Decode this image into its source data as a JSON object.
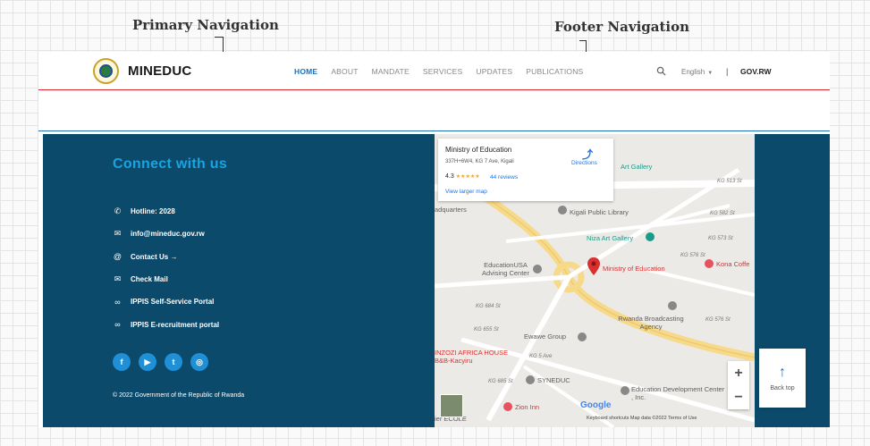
{
  "annotations": {
    "primary_nav": "Primary Navigation",
    "footer_nav": "Footer Navigation"
  },
  "header": {
    "brand": "MINEDUC",
    "nav": [
      "HOME",
      "ABOUT",
      "MANDATE",
      "SERVICES",
      "UPDATES",
      "PUBLICATIONS"
    ],
    "active_nav": "HOME",
    "language": "English",
    "separator": "|",
    "gov_link": "GOV.RW"
  },
  "footer": {
    "title": "Connect with us",
    "links": [
      {
        "icon": "phone-icon",
        "label": "Hotline: 2028"
      },
      {
        "icon": "mail-icon",
        "label": "info@mineduc.gov.rw"
      },
      {
        "icon": "at-icon",
        "label": "Contact Us →"
      },
      {
        "icon": "mail-icon",
        "label": "Check Mail"
      },
      {
        "icon": "link-icon",
        "label": "IPPIS Self-Service Portal"
      },
      {
        "icon": "link-icon",
        "label": "IPPIS E-recruitment portal"
      }
    ],
    "socials": [
      {
        "name": "facebook-icon",
        "glyph": "f"
      },
      {
        "name": "youtube-icon",
        "glyph": "▶"
      },
      {
        "name": "twitter-icon",
        "glyph": "t"
      },
      {
        "name": "instagram-icon",
        "glyph": "◎"
      }
    ],
    "copyright": "© 2022 Government of the Republic of Rwanda"
  },
  "map": {
    "card": {
      "name": "Ministry of Education",
      "address": "337H+6W4, KG 7 Ave, Kigali",
      "rating": "4.3",
      "stars": "★★★★★",
      "reviews": "44 reviews",
      "larger_map": "View larger map",
      "directions": "Directions"
    },
    "labels": {
      "art_gallery": "Art Gallery",
      "kg513": "KG 513 St",
      "kg582": "KG 582 St",
      "kg573": "KG 573 St",
      "kg576a": "KG 576 St",
      "kg576b": "KG 576 St",
      "headquarters": "adquarters",
      "kigali_library": "Kigali Public Library",
      "niza": "Niza Art Gallery",
      "kona": "Kona Coffe",
      "edusa": "EducationUSA Advising Center",
      "ministry": "Ministry of Education",
      "kg684": "KG 684 St",
      "kg655": "KG 655 St",
      "rwanda_bc": "Rwanda Broadcasting Agency",
      "ewawe": "Ewawe Group",
      "inzozi": "INZOZI AFRICA HOUSE B&B-Kacyiru",
      "kg5ave": "KG 5 Ave",
      "kg685": "KG 685 St",
      "syneduc": "SYNEDUC",
      "zion": "Zion Inn",
      "edc": "Education Development Center , Inc.",
      "ecole": "ier ECOLE"
    },
    "google": "Google",
    "footer": "Keyboard shortcuts   Map data ©2022   Terms of Use"
  },
  "back_top": {
    "arrow": "↑",
    "label": "Back top"
  }
}
